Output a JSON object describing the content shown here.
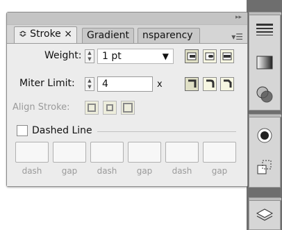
{
  "tabs": [
    {
      "label": "≎ Stroke ×",
      "active": true
    },
    {
      "label": "Gradient",
      "active": false
    },
    {
      "label": "nsparency",
      "active": false
    }
  ],
  "weight": {
    "label": "Weight:",
    "value": "1 pt"
  },
  "miter": {
    "label": "Miter Limit:",
    "value": "4",
    "unit": "x"
  },
  "align": {
    "label": "Align Stroke:"
  },
  "dashed": {
    "label": "Dashed Line",
    "checked": false
  },
  "dash_fields": [
    "dash",
    "gap",
    "dash",
    "gap",
    "dash",
    "gap"
  ],
  "colors": {
    "accent": "#f7f7e2",
    "panel": "#ececec",
    "dock": "#6e6e6e"
  }
}
